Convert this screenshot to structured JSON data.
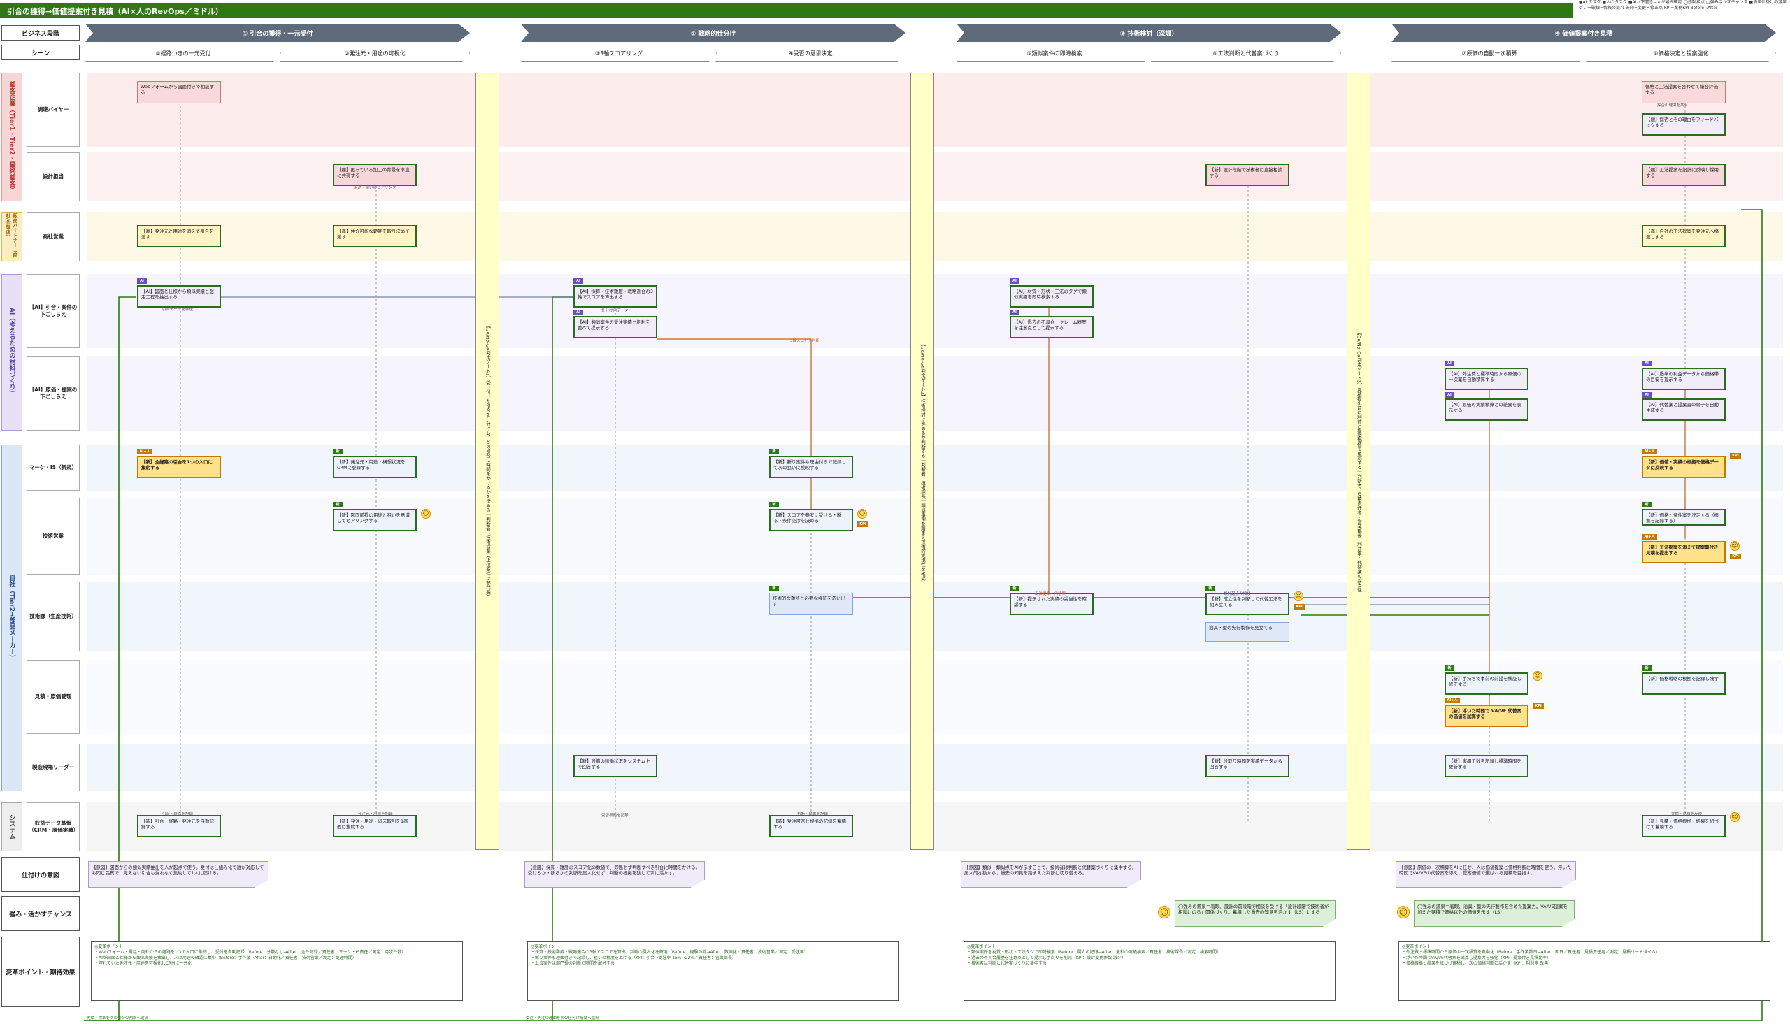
{
  "title": "引合の獲得→価値提案付き見積（AI×人のRevOps／ミドル）",
  "legend_note": "■AI タスク ■人のタスク ■AIが下書き→人が最終確認 ◯感動接点 □強み活かすチャンス ■価値仕掛けの源泉 グレー破線=情報の流れ 矢印=変更・修正点 KPI=業務KPI Before→After",
  "row_headers": {
    "business": "ビジネス段階",
    "scene": "シーン",
    "intent": "仕付けの意図",
    "strength": "強み・活かすチャンス",
    "change": "変革ポイント・期待効果"
  },
  "phases": [
    "① 引合の獲得・一元受付",
    "② 戦略的仕分け",
    "③ 技術検討（深堀）",
    "④ 価値提案付き見積"
  ],
  "scenes": [
    "①経路つきの一元受付",
    "②発注元・用途の可視化",
    "③3軸スコアリング",
    "④受否の意思決定",
    "⑤類似案件の即時検索",
    "⑥工法判断と代替案づくり",
    "⑦原価の自動一次積算",
    "⑧価格決定と提案強化"
  ],
  "groups": {
    "customer": "顧客企業（Tier1・Tier2・最終顧客）",
    "partner": "販売パートナー（商社/代理店）",
    "ai": "AI（考えるための材料づくり）",
    "company": "自社（Tier2→部品メーカー）",
    "system": "システム"
  },
  "lanes": [
    "調達バイヤー",
    "設計担当",
    "商社営業",
    "【AI】引合・案件の下ごしらえ",
    "【AI】原価・提案の下ごしらえ",
    "マーケ・IS（新規）",
    "技術営業",
    "技術課（生産技術）",
    "見積・原価管理",
    "製造現場リーダー",
    "収益データ基盤（CRM・原価実績）"
  ],
  "gates": [
    "【Go/No-Go判定ゲート1】受け付けた引合を仕分けし、どの引合に時間をかけるかを決める｜判断者：技術営業（上位案件は部門長）",
    "【Go/No-Go判定ゲート2】技術検討に進めるか判断する｜判断者：技術課長｜類似事例を踏まえ技術的実現性を確認",
    "【Go/No-Go判定ゲート3】見積提出前に利益と提案価値を確認する｜判断者：見積責任者・営業部長｜利益率・代替案の妥当性"
  ],
  "cards": [
    {
      "text": "Webフォームから図面付きで相談する"
    },
    {
      "text": "【顧】困っている加工の背景を率直に共有する"
    },
    {
      "text": "【商】発注元と用途を添えて引合を渡す"
    },
    {
      "text": "【商】仲介可能な範囲を取り決めて渡す"
    },
    {
      "text": "【AI】図面と仕様から類似実績と想定工程を抽出する"
    },
    {
      "text": "【AI】採算・技術難度・戦略適合の3軸でスコアを算出する"
    },
    {
      "text": "【AI】類似案件の受注実績と粗利を並べて提示する"
    },
    {
      "text": "【AI】材質・形状・工法のタグで類似実績を即時検索する"
    },
    {
      "text": "【AI】過去の不具合・クレーム履歴を注意点として提示する"
    },
    {
      "text": "【AI】外注費と標準時間から原価の一次案を自動積算する"
    },
    {
      "text": "【AI】原価の実績積算との差異を表示する"
    },
    {
      "text": "【AI】過半の利益データから価格帯の目安を提示する"
    },
    {
      "text": "【AI】代替案と提案書の骨子を自動生成する"
    },
    {
      "text": "【新】全経路の引合を1つの入口に集約する"
    },
    {
      "text": "【新】発注元・用途・構想状況をCRMに登録する"
    },
    {
      "text": "【新】図面前提の用途と狙いを意識してヒアリングする"
    },
    {
      "text": "【新】断り案件も理由付きで記録して次の狙いに反映する"
    },
    {
      "text": "【新】スコアを参考に受ける・断る・条件交渉を決める"
    },
    {
      "text": "技術的な難所と必要な検証を洗い出す"
    },
    {
      "text": "【新】提示された実績の妥当性を確認する"
    },
    {
      "text": "【新】成立性を判断して代替工法を組み立てる"
    },
    {
      "text": "治具・型の先行製作を見立てる"
    },
    {
      "text": "【新】手持ちで事前の前提を検証し修正する"
    },
    {
      "text": "【新】浮いた時間で VA/VE 代替案の価値を試算する"
    },
    {
      "text": "【新】価格戦略の根拠を記録し残す"
    },
    {
      "text": "【新】設備の稼働状況をシステム上で回答する"
    },
    {
      "text": "【新】段取り時間を実績データから回答する"
    },
    {
      "text": "【新】実績工数を記録し標準時間を更新する"
    },
    {
      "text": "【新】引合・経路・発注元を自動記録する"
    },
    {
      "text": "【新】発注・用途・過去取引を1画面に集約する"
    },
    {
      "text": "【新】受注可否と根拠の記録を蓄積する"
    },
    {
      "text": "【新】見積・価格根拠・結果を紐づけて蓄積する"
    },
    {
      "text": "【新】設計段階で技術者に直接相談する"
    },
    {
      "text": "価格と工法提案を合わせて総合評価する"
    },
    {
      "text": "【顧】採否とその理由をフィードバックする"
    },
    {
      "text": "【顧】工法提案を設計に反映し採用する"
    },
    {
      "text": "【商】自社の工法提案を発注元へ橋渡しする"
    },
    {
      "text": "【新】価値・実績の根拠を価格データに反映する"
    },
    {
      "text": "【新】価格と条件案を決定する（根拠を記録する）"
    },
    {
      "text": "【新】工法提案を添えて提案書付き見積を提出する"
    },
    {
      "text": "【新】価格戦略の根拠を記録し残す"
    }
  ],
  "badges": {
    "ai": "AI",
    "new": "新",
    "ai_person": "AI+人",
    "kpi": "KPI"
  },
  "flow_labels": [
    "引合データを転送",
    "用途・狙いのヒアリング",
    "仕分け用データ",
    "3軸スコアで判断",
    "引合・経路を記録",
    "発注元・用途を記録",
    "受否根拠を記録",
    "判断・結果を記録",
    "工法提案・代替案",
    "実績・見積を反映",
    "設計起点の相談",
    "採否の理由を共有"
  ],
  "intents": [
    "【意図】図面からの類似実績抽出を人が起点で使う。受付は仕組み化で誰が対応しても同じ品質で、見えない引合も漏れなく集約して1人に届ける。",
    "【意図】採算・難度のスコア化の数値で、即断せず判断すべき引合に時間をかける。受けるか・断るかの判断を属人化せず、判断の根拠を残して次に活かす。",
    "【意図】類似・類似点をAIが示すことで、技術者は判断と代替案づくりに集中する。属人的な勘から、過去の知見を踏まえた判断に切り替える。",
    "【意図】原価の一次積算をAIに任せ、人は価値提案と価格判断に時間を使う。浮いた時間でVA/VEの代替案を添え、提案価値で選ばれる見積を目指す。"
  ],
  "strengths": [
    "◯強みの源泉＝着眼、設計の前段階で相談を受ける「設計段階で技術者が相談にのる」関係づくり。蓄積した過去の知見を活かす（LS）にする",
    "◯強みの源泉＝着眼、治具・型の先行製作を含めた提案力。VA/VE提案を加えた見積で価格以外の価値を示す（LS）"
  ],
  "changes": [
    "◎変革ポイント\n・Webフォーム・電話・商社からの経路を1つの入口に集約し、受付を自動記録（Before：分散なし→After：全件記録／責任者：マーケ・IS責任／測定：月次件数）\n・AIが図面と仕様から類似実績を抽出し、人は用途の確認に集中（Before：手作業→After：自動化／責任者：技術営業／測定：処理時間）\n・埋れていた発注元・用途を可視化しCRMに一元化",
    "◎変革ポイント\n・採算・技術難度・戦略適合の3軸でスコアを算出、判断の属人化を解消（Before：経験の勘→After：数値化／責任者：技術営業／測定：受注率）\n・断り案件も理由付きで記録し、狙いの精度を上げる（KPI：引合→受注率 15%→22%／責任者：営業部長）\n・上位案件は部門長の判断で時間を配分する",
    "◎変革ポイント\n・類似案件を材質・形状・工法タグで即時検索（Before：属人の記憶→After：全社の実績検索／責任者：技術課長／測定：検索時間）\n・過去の不具合履歴を注意点として提示し手戻りを削減（KPI：設計変更件数 減少）\n・技術者は判断と代替案づくりに集中する",
    "◎変革ポイント\n・外注費・標準時間から原価の一次積算を自動化（Before：手作業数日→After：即日／責任者：見積責任者／測定：見積リードタイム）\n・浮いた時間でVA/VE代替案を試算し提案力を強化（KPI：提案付き見積比率）\n・価格根拠と結果を紐づけ蓄積し、次の価格判断に活かす（KPI：粗利率 改善）"
  ],
  "feedback_labels": [
    "実績・標準を次の引合の判断へ還流",
    "受注・失注の理由を次の仕分け精度へ還流"
  ],
  "colors": {
    "title_bg": "#2d7a15",
    "phase_bg": "#5f6b7a",
    "customer_band": "#fdecec",
    "partner_band": "#fef9e6",
    "ai_band": "#f6f4fd",
    "company_band": "#f1f6fc",
    "system_band": "#f6f6f6",
    "gate": "#ffffc8"
  }
}
